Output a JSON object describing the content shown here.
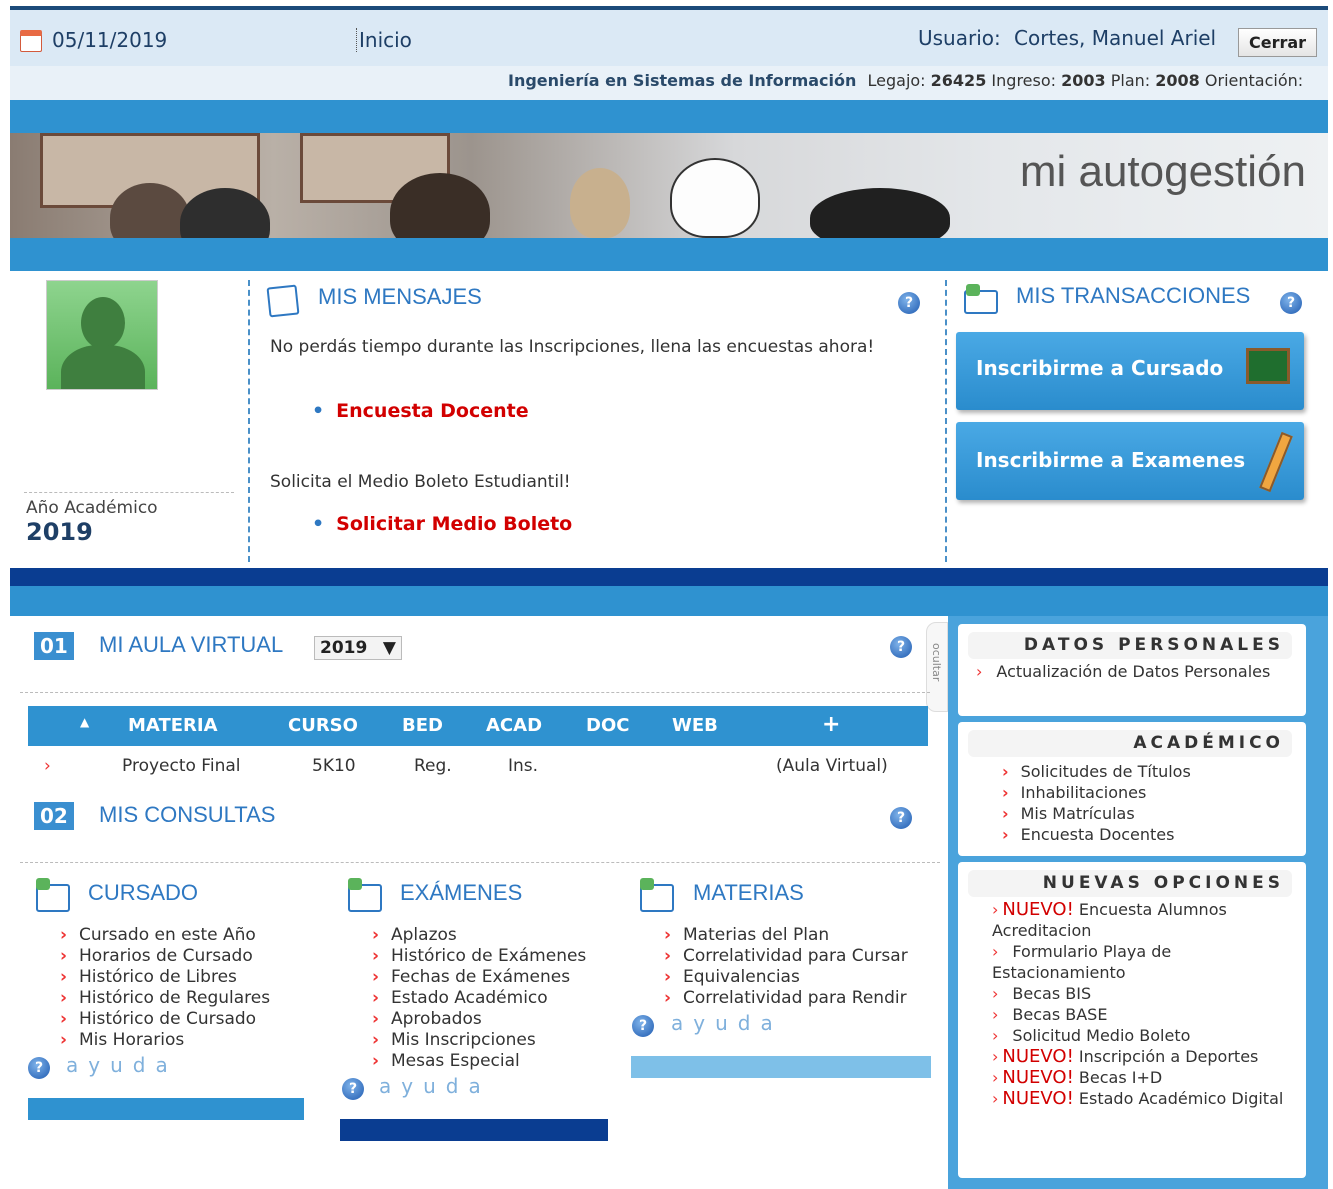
{
  "header": {
    "date": "05/11/2019",
    "inicio": "Inicio",
    "usuario_label": "Usuario:",
    "usuario_name": "Cortes, Manuel Ariel",
    "cerrar": "Cerrar",
    "career": "Ingeniería en Sistemas de Información",
    "legajo_label": "Legajo:",
    "legajo": "26425",
    "ingreso_label": "Ingreso:",
    "ingreso": "2003",
    "plan_label": "Plan:",
    "plan": "2008",
    "orientacion_label": "Orientación:"
  },
  "banner": {
    "title": "mi autogestión"
  },
  "profile": {
    "anio_label": "Año Académico",
    "anio": "2019"
  },
  "mensajes": {
    "title": "MIS MENSAJES",
    "msg1": "No perdás tiempo durante las Inscripciones, llena las encuestas ahora!",
    "link1": "Encuesta Docente",
    "msg2": "Solicita el Medio Boleto Estudiantil!",
    "link2": "Solicitar Medio Boleto"
  },
  "transacciones": {
    "title": "MIS TRANSACCIONES",
    "btn1": "Inscribirme a Cursado",
    "btn2": "Inscribirme a Examenes"
  },
  "aula": {
    "num": "01",
    "title": "MI AULA VIRTUAL",
    "year_select": "2019",
    "columns": [
      "MATERIA",
      "CURSO",
      "BED",
      "ACAD",
      "DOC",
      "WEB",
      "+"
    ],
    "row": {
      "materia": "Proyecto Final",
      "curso": "5K10",
      "bed": "Reg.",
      "acad": "Ins.",
      "link": "(Aula Virtual)"
    },
    "ocultar": "ocultar"
  },
  "consultas": {
    "num": "02",
    "title": "MIS CONSULTAS",
    "cursado": {
      "title": "CURSADO",
      "items": [
        "Cursado en este Año",
        "Horarios de Cursado",
        "Histórico de Libres",
        "Histórico de Regulares",
        "Histórico de Cursado",
        "Mis Horarios"
      ]
    },
    "examenes": {
      "title": "EXÁMENES",
      "items": [
        "Aplazos",
        "Histórico de Exámenes",
        "Fechas de Exámenes",
        "Estado Académico",
        "Aprobados",
        "Mis Inscripciones",
        "Mesas Especial"
      ]
    },
    "materias": {
      "title": "MATERIAS",
      "items": [
        "Materias del Plan",
        "Correlatividad para Cursar",
        "Equivalencias",
        "Correlatividad para Rendir"
      ]
    },
    "ayuda": "ayuda"
  },
  "sidebar": {
    "datos": {
      "title": "DATOS PERSONALES",
      "item": "Actualización de Datos Personales"
    },
    "academico": {
      "title": "ACADÉMICO",
      "items": [
        "Solicitudes de Títulos",
        "Inhabilitaciones",
        "Mis Matrículas",
        "Encuesta Docentes"
      ]
    },
    "nuevas": {
      "title": "NUEVAS OPCIONES",
      "nuevo": "NUEVO!",
      "item1": "Encuesta Alumnos Acreditacion",
      "item2": "Formulario Playa de Estacionamiento",
      "item3": "Becas BIS",
      "item4": "Becas BASE",
      "item5": "Solicitud Medio Boleto",
      "item6": "Inscripción a Deportes",
      "item7": "Becas I+D",
      "item8": "Estado Académico Digital"
    }
  },
  "colors": {
    "accent": "#2f92d0",
    "dark": "#0a3d91",
    "title": "#2e78c2",
    "link_red": "#d20000"
  }
}
